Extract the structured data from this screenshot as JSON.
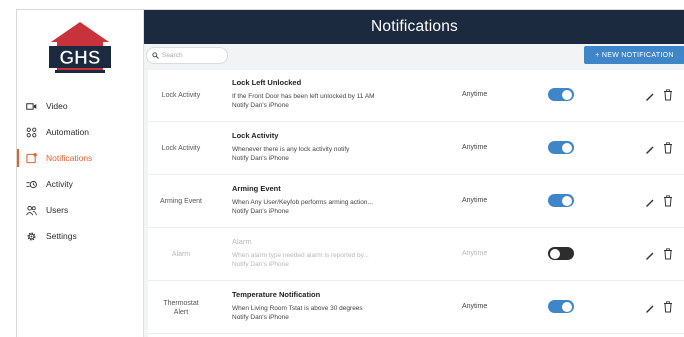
{
  "app": {
    "logo_text": "GHS",
    "title": "Notifications"
  },
  "sidebar": {
    "items": [
      {
        "label": "Video",
        "icon": "video-camera-icon",
        "active": false
      },
      {
        "label": "Automation",
        "icon": "automation-icon",
        "active": false
      },
      {
        "label": "Notifications",
        "icon": "notification-icon",
        "active": true
      },
      {
        "label": "Activity",
        "icon": "activity-icon",
        "active": false
      },
      {
        "label": "Users",
        "icon": "users-icon",
        "active": false
      },
      {
        "label": "Settings",
        "icon": "gear-icon",
        "active": false
      }
    ]
  },
  "toolbar": {
    "search_placeholder": "Search",
    "new_button_label": "+ NEW NOTIFICATION"
  },
  "colors": {
    "header_bg": "#1b2a3f",
    "accent_blue": "#3e86c8",
    "active_orange": "#e2612e",
    "logo_red": "#c8323b"
  },
  "notifications": [
    {
      "type": "Lock Activity",
      "title": "Lock Left Unlocked",
      "description": "If the Front Door has been left unlocked by 11 AM",
      "notify": "Notify Dan's iPhone",
      "time": "Anytime",
      "enabled": true
    },
    {
      "type": "Lock Activity",
      "title": "Lock Activity",
      "description": "Whenever there is any lock activity notify",
      "notify": "Notify Dan's iPhone",
      "time": "Anytime",
      "enabled": true
    },
    {
      "type": "Arming Event",
      "title": "Arming Event",
      "description": "When Any User/Keyfob performs arming action...",
      "notify": "Notify Dan's iPhone",
      "time": "Anytime",
      "enabled": true
    },
    {
      "type": "Alarm",
      "title": "Alarm",
      "description": "When alarm type needed alarm is reported by...",
      "notify": "Notify Dan's iPhone",
      "time": "Anytime",
      "enabled": false
    },
    {
      "type": "Thermostat Alert",
      "title": "Temperature Notification",
      "description": "When Living Room Tstat is above 30 degrees",
      "notify": "Notify Dan's iPhone",
      "time": "Anytime",
      "enabled": true
    }
  ]
}
